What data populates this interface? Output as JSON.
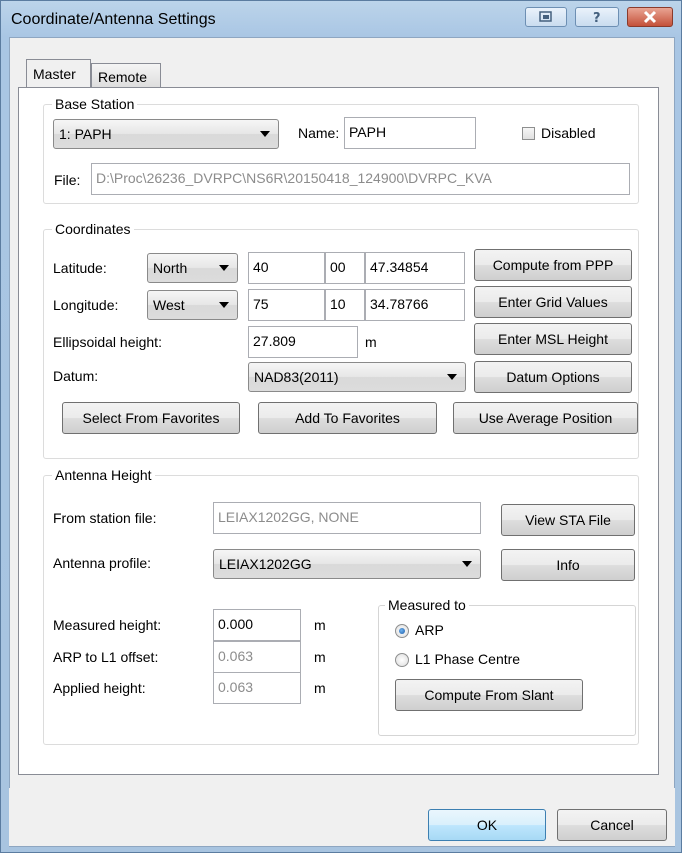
{
  "window": {
    "title": "Coordinate/Antenna Settings",
    "caption_icons": [
      "restore-icon",
      "help-icon",
      "close-icon"
    ],
    "colors": {
      "frame": "#a9c6e4",
      "client": "#f0f0f0",
      "close": "#c4513a"
    }
  },
  "tabs": [
    {
      "label": "Master",
      "active": true
    },
    {
      "label": "Remote",
      "active": false
    }
  ],
  "base_station": {
    "legend": "Base Station",
    "station_selected": "1: PAPH",
    "name_label": "Name:",
    "name_value": "PAPH",
    "disabled_label": "Disabled",
    "disabled_checked": false,
    "file_label": "File:",
    "file_value": "D:\\Proc\\26236_DVRPC\\NS6R\\20150418_124900\\DVRPC_KVA"
  },
  "coordinates": {
    "legend": "Coordinates",
    "latitude_label": "Latitude:",
    "latitude_hemisphere": "North",
    "latitude_deg": "40",
    "latitude_min": "00",
    "latitude_sec": "47.34854",
    "longitude_label": "Longitude:",
    "longitude_hemisphere": "West",
    "longitude_deg": "75",
    "longitude_min": "10",
    "longitude_sec": "34.78766",
    "ellipsoidal_label": "Ellipsoidal height:",
    "ellipsoidal_value": "27.809",
    "ellipsoidal_unit": "m",
    "datum_label": "Datum:",
    "datum_value": "NAD83(2011)",
    "compute_ppp": "Compute from PPP",
    "enter_grid": "Enter Grid Values",
    "enter_msl": "Enter MSL Height",
    "datum_options": "Datum Options",
    "select_favorites": "Select From Favorites",
    "add_favorites": "Add To Favorites",
    "use_average": "Use Average Position"
  },
  "antenna": {
    "legend": "Antenna Height",
    "from_station_label": "From station file:",
    "from_station_value": "LEIAX1202GG, NONE",
    "view_sta": "View STA File",
    "profile_label": "Antenna profile:",
    "profile_value": "LEIAX1202GG",
    "info": "Info",
    "measured_label": "Measured height:",
    "measured_value": "0.000",
    "arp_offset_label": "ARP to L1 offset:",
    "arp_offset_value": "0.063",
    "applied_label": "Applied height:",
    "applied_value": "0.063",
    "unit": "m",
    "measured_to_legend": "Measured to",
    "arp_option": "ARP",
    "l1_option": "L1 Phase Centre",
    "selected_option": "ARP",
    "compute_slant": "Compute From Slant"
  },
  "footer": {
    "ok": "OK",
    "cancel": "Cancel"
  }
}
